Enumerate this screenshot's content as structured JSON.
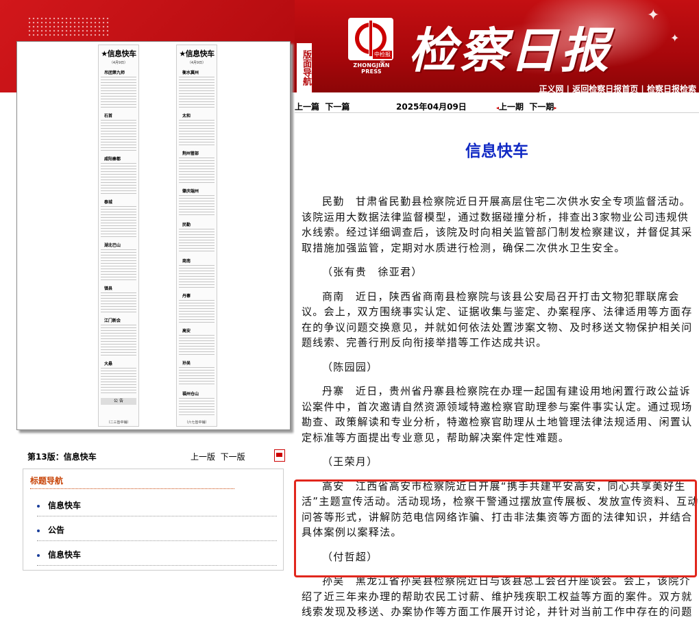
{
  "header": {
    "masthead": "检察日报",
    "logo_stamp": "中检报业",
    "logo_press": "ZHONGJIAN PRESS",
    "layout_nav_tab": "版面导航",
    "top_links": [
      "正义网",
      "返回检察日报首页",
      "检察日报检索"
    ],
    "link_separator": " | "
  },
  "page_thumbnail": {
    "columns": [
      {
        "title": "★信息快车",
        "date": "（4月9日）",
        "heads": [
          "吊团第九师",
          "石首",
          "咸阳秦都",
          "泰城",
          "湖北巴山",
          "镇县",
          "江门新会",
          "大悬"
        ],
        "ad_label": "公 告",
        "footer": "（二三皆中铺）"
      },
      {
        "title": "★信息快车",
        "date": "（4月9日）",
        "heads": [
          "衡水冀州",
          "太和",
          "荆州管部",
          "肇庆端州",
          "民勤",
          "商南",
          "丹寨",
          "高安",
          "孙吴",
          "福州仓山"
        ],
        "ad_label": "",
        "footer": "（六七皆中铺）"
      }
    ]
  },
  "left_info": {
    "issue_label": "第13版：信息快车",
    "prev_page": "上一版",
    "next_page": "下一版"
  },
  "nav_box": {
    "title": "标题导航",
    "items": [
      "信息快车",
      "公告",
      "信息快车"
    ]
  },
  "toolbar": {
    "prev_article": "上一篇",
    "next_article": "下一篇",
    "date": "2025年04月09日",
    "prev_issue": "上一期",
    "next_issue": "下一期"
  },
  "article": {
    "title": "信息快车",
    "paragraphs": [
      {
        "text": "民勤　甘肃省民勤县检察院近日开展高层住宅二次供水安全专项监督活动。该院运用大数据法律监督模型，通过数据碰撞分析，排查出3家物业公司违规供水线索。经过详细调查后，该院及时向相关监管部门制发检察建议，并督促其采取措施加强监管，定期对水质进行检测，确保二次供水卫生安全。",
        "author": "（张有贵　徐亚君）"
      },
      {
        "text": "商南　近日，陕西省商南县检察院与该县公安局召开打击文物犯罪联席会议。会上，双方围绕事实认定、证据收集与鉴定、办案程序、法律适用等方面存在的争议问题交换意见，并就如何依法处置涉案文物、及时移送文物保护相关问题线索、完善行刑反向衔接举措等工作达成共识。",
        "author": "（陈园园）"
      },
      {
        "text": "丹寨　近日，贵州省丹寨县检察院在办理一起国有建设用地闲置行政公益诉讼案件中，首次邀请自然资源领域特邀检察官助理参与案件事实认定。通过现场勘查、政策解读和专业分析，特邀检察官助理从土地管理法律法规适用、闲置认定标准等方面提出专业意见，帮助解决案件定性难题。",
        "author": "（王荣月）"
      },
      {
        "text": "高安　江西省高安市检察院近日开展“携手共建平安高安，同心共享美好生活”主题宣传活动。活动现场，检察干警通过摆放宣传展板、发放宣传资料、互动问答等形式，讲解防范电信网络诈骗、打击非法集资等方面的法律知识，并结合具体案例以案释法。",
        "author": "（付哲超）"
      },
      {
        "text": "孙吴　黑龙江省孙吴县检察院近日与该县总工会召开座谈会。会上，该院介绍了近三年来办理的帮助农民工讨薪、维护残疾职工权益等方面的案件。双方就线索发现及移送、办案协作等方面工作展开讨论，并针对当前工作中存在的问题",
        "author": ""
      }
    ]
  },
  "colors": {
    "banner_red": "#b00a0e",
    "title_blue": "#1029c4",
    "nav_title_orange": "#c8460a",
    "highlight_red": "#e1261c"
  }
}
